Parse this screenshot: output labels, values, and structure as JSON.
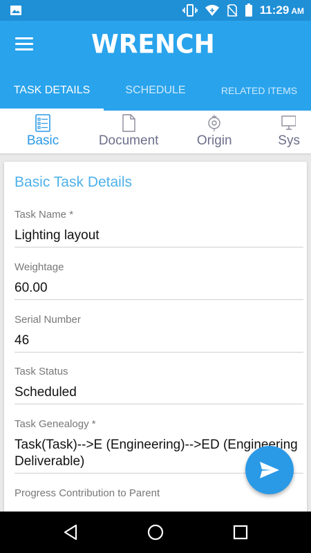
{
  "status_bar": {
    "time": "11:29",
    "ampm": "AM",
    "icons": [
      "image-icon",
      "vibrate-icon",
      "wifi-icon",
      "no-sim-icon",
      "battery-icon"
    ]
  },
  "app_bar": {
    "logo": "WRENCH",
    "menu_icon": "hamburger-icon"
  },
  "tabs": [
    {
      "label": "TASK DETAILS",
      "active": true
    },
    {
      "label": "SCHEDULE",
      "active": false
    },
    {
      "label": "RELATED ITEMS",
      "active": false
    }
  ],
  "subtabs": [
    {
      "label": "Basic",
      "icon": "checklist-icon",
      "active": true
    },
    {
      "label": "Document",
      "icon": "document-icon",
      "active": false
    },
    {
      "label": "Origin",
      "icon": "origin-icon",
      "active": false
    },
    {
      "label": "Sys",
      "icon": "system-icon",
      "active": false
    }
  ],
  "card": {
    "title": "Basic Task Details",
    "fields": [
      {
        "label": "Task Name *",
        "value": "Lighting layout"
      },
      {
        "label": "Weightage",
        "value": "60.00"
      },
      {
        "label": "Serial Number",
        "value": "46"
      },
      {
        "label": "Task Status",
        "value": "Scheduled"
      },
      {
        "label": "Task Genealogy *",
        "value": "Task(Task)-->E (Engineering)-->ED (Engineering Deliverable)"
      },
      {
        "label": "Progress Contribution to Parent",
        "value": ""
      }
    ]
  },
  "fab": {
    "icon": "send-icon"
  },
  "colors": {
    "primary": "#29a3ec",
    "status_bar": "#1f8fd6",
    "accent": "#2a99e6",
    "title": "#4db1ea"
  }
}
